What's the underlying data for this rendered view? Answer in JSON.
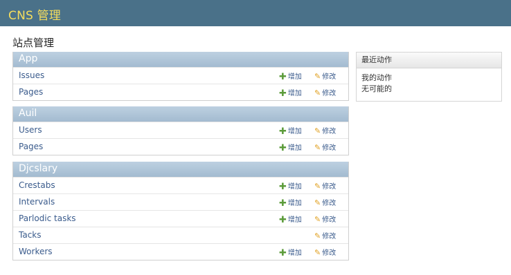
{
  "header": {
    "title": "CNS 管理"
  },
  "page": {
    "title": "站点管理"
  },
  "modules": [
    {
      "caption": "App",
      "rows": [
        {
          "label": "Issues",
          "add": "增加",
          "change": "修改"
        },
        {
          "label": "Pages",
          "add": "增加",
          "change": "修改"
        }
      ]
    },
    {
      "caption": "Auil",
      "rows": [
        {
          "label": "Users",
          "add": "增加",
          "change": "修改"
        },
        {
          "label": "Pages",
          "add": "增加",
          "change": "修改"
        }
      ]
    },
    {
      "caption": "Djcslary",
      "rows": [
        {
          "label": "Crestabs",
          "add": "增加",
          "change": "修改"
        },
        {
          "label": "Intervals",
          "add": "增加",
          "change": "修改"
        },
        {
          "label": "Parlodic tasks",
          "add": "增加",
          "change": "修改"
        },
        {
          "label": "Tacks",
          "add": null,
          "change": "修改"
        },
        {
          "label": "Workers",
          "add": "增加",
          "change": "修改"
        }
      ]
    }
  ],
  "recent_actions": {
    "title": "最近动作",
    "my_actions": "我的动作",
    "none": "无可能的"
  },
  "colors": {
    "header_bg": "#4a7189",
    "header_text": "#f5dd5d",
    "caption_bg": "#a3bbd0",
    "link": "#3a5b8c",
    "add_icon": "#5b9b3a",
    "change_icon": "#e0a020"
  },
  "icons": {
    "add": "plus-icon",
    "change": "pencil-icon"
  }
}
